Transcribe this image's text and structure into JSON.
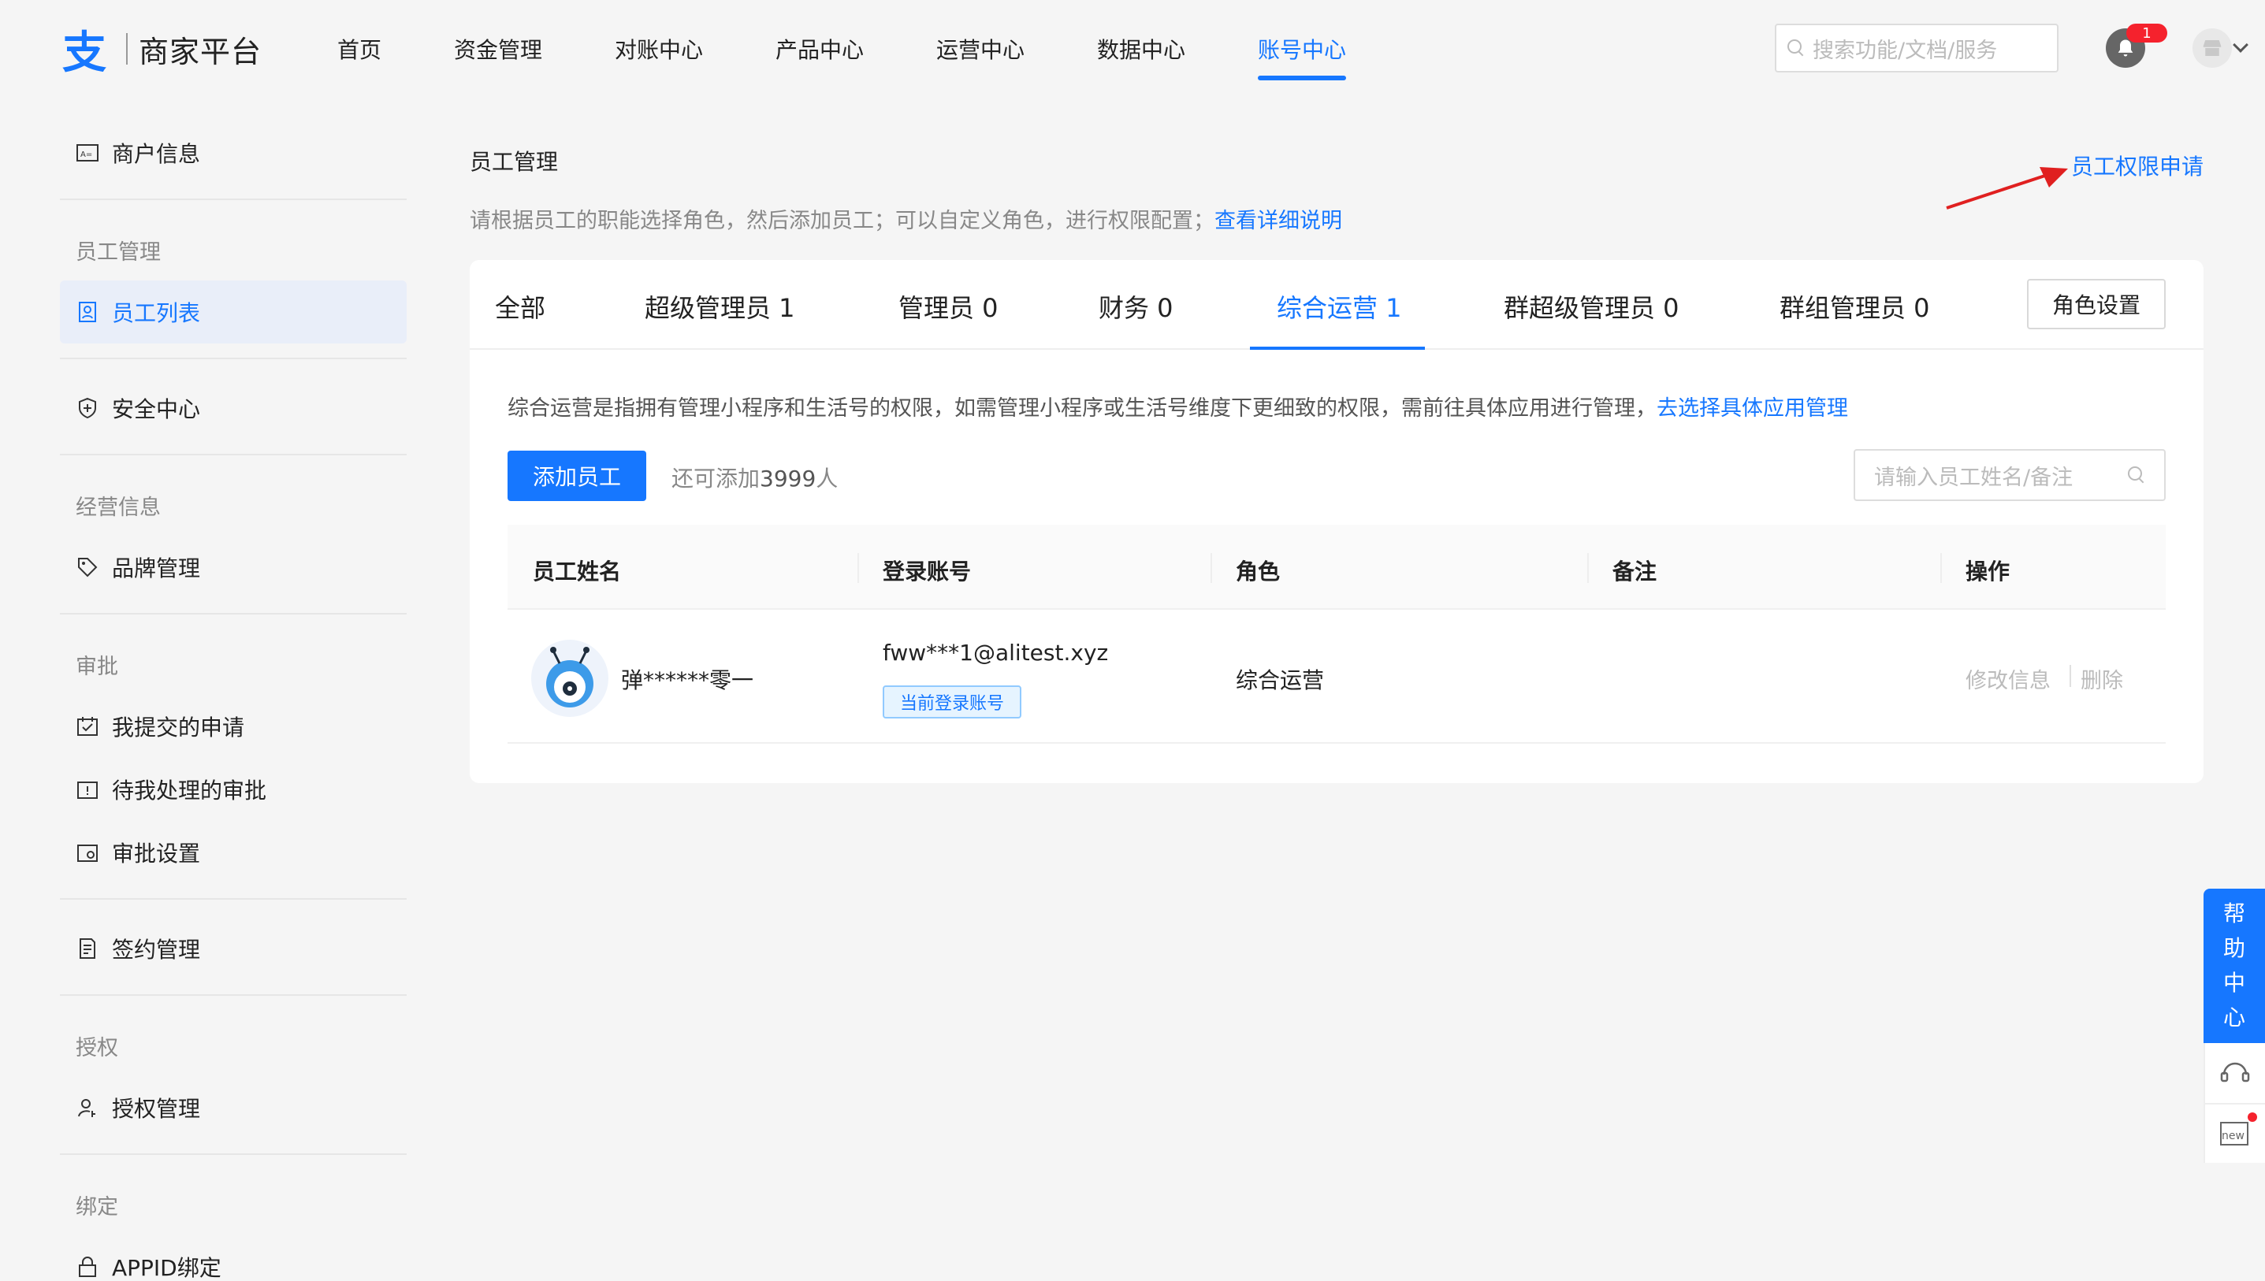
{
  "header": {
    "logo_mark": "支",
    "logo_text": "商家平台",
    "nav": [
      "首页",
      "资金管理",
      "对账中心",
      "产品中心",
      "运营中心",
      "数据中心",
      "账号中心"
    ],
    "active_nav": "账号中心",
    "search_placeholder": "搜索功能/文档/服务",
    "notification_count": "1"
  },
  "sidebar": {
    "merchant_info": "商户信息",
    "group_staff": "员工管理",
    "staff_list": "员工列表",
    "security_center": "安全中心",
    "group_business": "经营信息",
    "brand_management": "品牌管理",
    "group_approval": "审批",
    "my_requests": "我提交的申请",
    "pending_approvals": "待我处理的审批",
    "approval_settings": "审批设置",
    "contract_management": "签约管理",
    "group_auth": "授权",
    "auth_management": "授权管理",
    "group_binding": "绑定",
    "appid_binding": "APPID绑定"
  },
  "main": {
    "title": "员工管理",
    "permission_link": "员工权限申请",
    "description": "请根据员工的职能选择角色，然后添加员工；可以自定义角色，进行权限配置；",
    "description_link": "查看详细说明",
    "tabs": [
      {
        "label": "全部"
      },
      {
        "label": "超级管理员  1"
      },
      {
        "label": "管理员  0"
      },
      {
        "label": "财务  0"
      },
      {
        "label": "综合运营  1"
      },
      {
        "label": "群超级管理员  0"
      },
      {
        "label": "群组管理员  0"
      }
    ],
    "active_tab": "综合运营  1",
    "role_settings": "角色设置",
    "tip": "综合运营是指拥有管理小程序和生活号的权限，如需管理小程序或生活号维度下更细致的权限，需前往具体应用进行管理，",
    "tip_link": "去选择具体应用管理",
    "add_button": "添加员工",
    "quota_prefix": "还可添加",
    "quota_number": "3999",
    "quota_suffix": "人",
    "search_placeholder": "请输入员工姓名/备注",
    "table": {
      "headers": [
        "员工姓名",
        "登录账号",
        "角色",
        "备注",
        "操作"
      ],
      "rows": [
        {
          "name": "弹******零一",
          "account": "fww***1@alitest.xyz",
          "account_badge": "当前登录账号",
          "role": "综合运营",
          "remark": "",
          "actions": [
            "修改信息",
            "删除"
          ]
        }
      ]
    }
  },
  "help": {
    "label_chars": [
      "帮",
      "助",
      "中",
      "心"
    ],
    "new_label": "new"
  },
  "colors": {
    "accent": "#1677ff",
    "annotation_arrow": "#e02020",
    "badge": "#f5222d"
  }
}
